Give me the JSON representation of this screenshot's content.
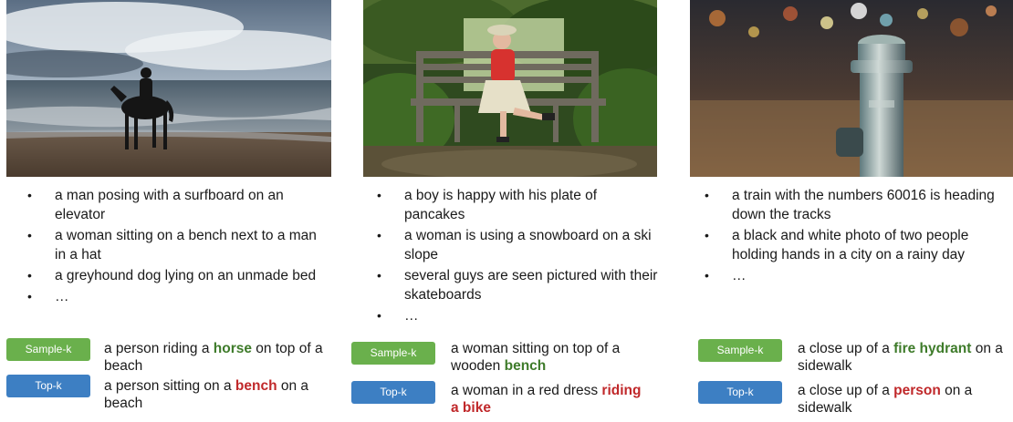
{
  "panels": [
    {
      "photo": "beach-horse-rider-photo",
      "captions": [
        "a man posing with a surfboard on an elevator",
        "a woman sitting on a bench next to a man in a hat",
        "a greyhound dog lying on an unmade bed",
        "…"
      ],
      "sample_k": {
        "label": "Sample-k",
        "pre": "a person riding a ",
        "highlight": "horse",
        "post": " on top of a beach"
      },
      "top_k": {
        "label": "Top-k",
        "pre": "a person sitting on a ",
        "highlight": "bench",
        "post": " on a beach"
      }
    },
    {
      "photo": "woman-on-bench-photo",
      "captions": [
        "a boy is happy with his plate of pancakes",
        "a woman is using a snowboard on a ski slope",
        "several guys are seen pictured with their skateboards",
        "…"
      ],
      "sample_k": {
        "label": "Sample-k",
        "pre": "a woman sitting on top of a wooden ",
        "highlight": "bench",
        "post": ""
      },
      "top_k": {
        "label": "Top-k",
        "pre": "a woman in a red dress ",
        "highlight": "riding a bike",
        "post": ""
      }
    },
    {
      "photo": "fire-hydrant-night-photo",
      "captions": [
        "a train with the numbers 60016 is heading down the tracks",
        "a black and white photo of two people holding hands in a city on a rainy day",
        "…"
      ],
      "sample_k": {
        "label": "Sample-k",
        "pre": "a close up of a ",
        "highlight": "fire hydrant",
        "post": " on a sidewalk"
      },
      "top_k": {
        "label": "Top-k",
        "pre": "a close up of a ",
        "highlight": "person",
        "post": " on a sidewalk"
      }
    }
  ],
  "colors": {
    "sample_badge": "#6ab04c",
    "top_badge": "#3d7fc3",
    "good_word": "#3e7b2a",
    "bad_word": "#c0282a"
  }
}
